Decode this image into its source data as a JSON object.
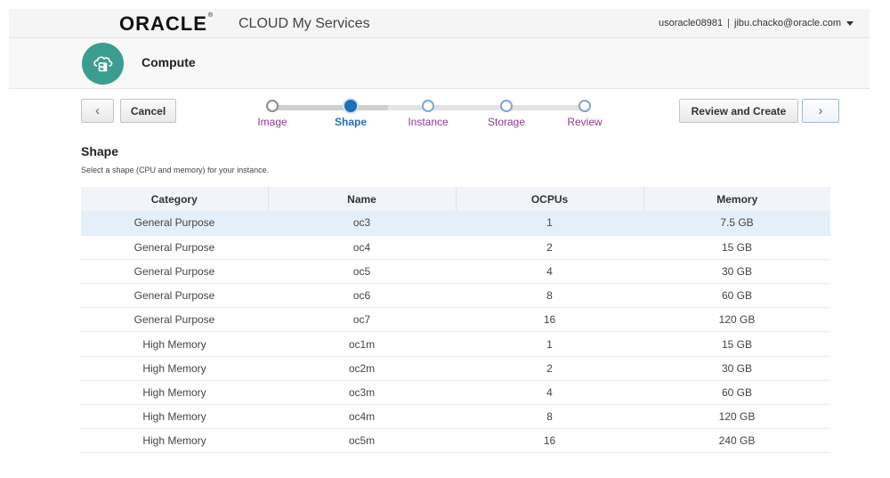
{
  "header": {
    "brand": "ORACLE",
    "brand_mark": "®",
    "product": "CLOUD My Services",
    "identity_domain": "usoracle08981",
    "separator": "|",
    "user": "jibu.chacko@oracle.com"
  },
  "service": {
    "title": "Compute",
    "icon": "cloud-server-icon",
    "accent_color": "#3a9d8f"
  },
  "toolbar": {
    "back_glyph": "‹",
    "cancel_label": "Cancel",
    "review_label": "Review and Create",
    "next_glyph": "›"
  },
  "train": {
    "steps": [
      {
        "label": "Image",
        "state": "visited"
      },
      {
        "label": "Shape",
        "state": "current"
      },
      {
        "label": "Instance",
        "state": "unvisited"
      },
      {
        "label": "Storage",
        "state": "unvisited"
      },
      {
        "label": "Review",
        "state": "unvisited"
      }
    ]
  },
  "section": {
    "title": "Shape",
    "description": "Select a shape (CPU and memory) for your instance."
  },
  "table": {
    "columns": [
      "Category",
      "Name",
      "OCPUs",
      "Memory"
    ],
    "selected_row": 0,
    "rows": [
      [
        "General Purpose",
        "oc3",
        "1",
        "7.5 GB"
      ],
      [
        "General Purpose",
        "oc4",
        "2",
        "15 GB"
      ],
      [
        "General Purpose",
        "oc5",
        "4",
        "30 GB"
      ],
      [
        "General Purpose",
        "oc6",
        "8",
        "60 GB"
      ],
      [
        "General Purpose",
        "oc7",
        "16",
        "120 GB"
      ],
      [
        "High Memory",
        "oc1m",
        "1",
        "15 GB"
      ],
      [
        "High Memory",
        "oc2m",
        "2",
        "30 GB"
      ],
      [
        "High Memory",
        "oc3m",
        "4",
        "60 GB"
      ],
      [
        "High Memory",
        "oc4m",
        "8",
        "120 GB"
      ],
      [
        "High Memory",
        "oc5m",
        "16",
        "240 GB"
      ]
    ]
  },
  "colors": {
    "current_step": "#1f6fba",
    "step_label": "#8a3d8f",
    "selected_row": "#e5eff9"
  }
}
